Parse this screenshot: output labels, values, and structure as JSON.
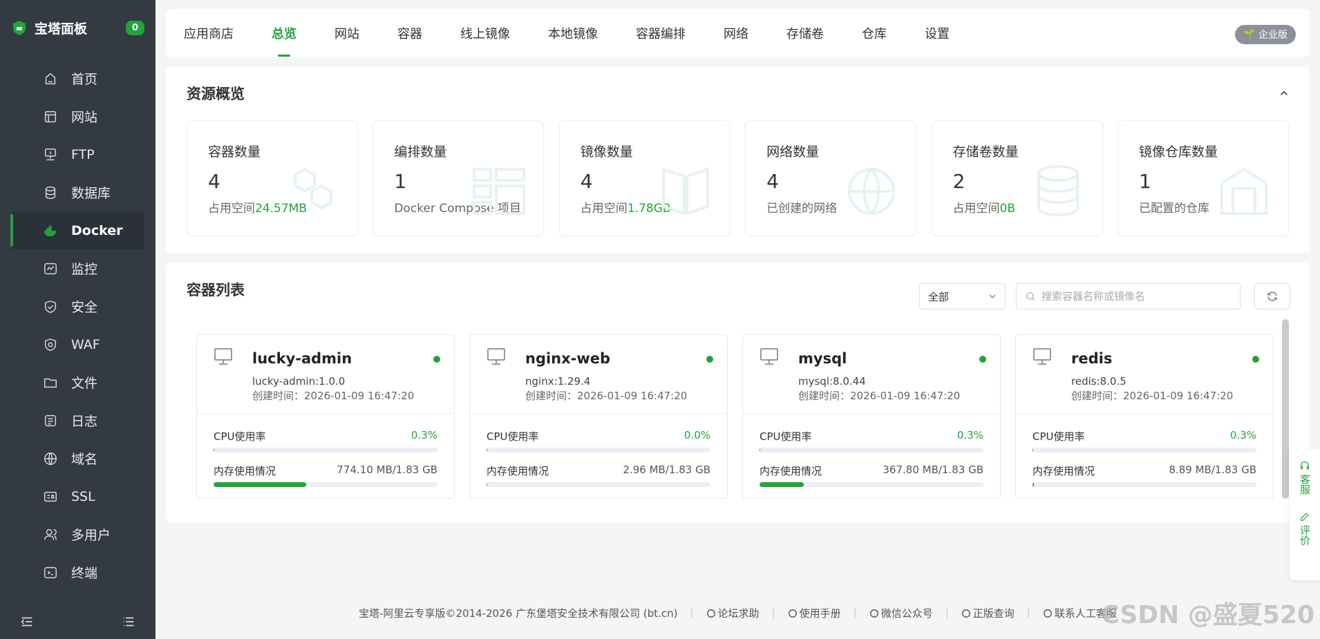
{
  "brand": {
    "title": "宝塔面板",
    "badge": "0"
  },
  "sidebar": {
    "items": [
      {
        "label": "首页",
        "icon": "home-icon"
      },
      {
        "label": "网站",
        "icon": "website-icon"
      },
      {
        "label": "FTP",
        "icon": "ftp-icon"
      },
      {
        "label": "数据库",
        "icon": "database-icon"
      },
      {
        "label": "Docker",
        "icon": "docker-icon",
        "active": true
      },
      {
        "label": "监控",
        "icon": "monitor-icon"
      },
      {
        "label": "安全",
        "icon": "shield-icon"
      },
      {
        "label": "WAF",
        "icon": "waf-icon"
      },
      {
        "label": "文件",
        "icon": "folder-icon"
      },
      {
        "label": "日志",
        "icon": "log-icon"
      },
      {
        "label": "域名",
        "icon": "globe-icon"
      },
      {
        "label": "SSL",
        "icon": "ssl-icon"
      },
      {
        "label": "多用户",
        "icon": "users-icon"
      },
      {
        "label": "终端",
        "icon": "terminal-icon"
      }
    ]
  },
  "tabs": [
    "应用商店",
    "总览",
    "网站",
    "容器",
    "线上镜像",
    "本地镜像",
    "容器编排",
    "网络",
    "存储卷",
    "仓库",
    "设置"
  ],
  "active_tab": "总览",
  "enterprise_label": "企业版",
  "overview": {
    "title": "资源概览",
    "stats": [
      {
        "label": "容器数量",
        "value": "4",
        "sub_prefix": "占用空间",
        "sub_value": "24.57MB"
      },
      {
        "label": "编排数量",
        "value": "1",
        "sub_prefix": "Docker Compose 项目",
        "sub_value": ""
      },
      {
        "label": "镜像数量",
        "value": "4",
        "sub_prefix": "占用空间",
        "sub_value": "1.78GB"
      },
      {
        "label": "网络数量",
        "value": "4",
        "sub_prefix": "已创建的网络",
        "sub_value": ""
      },
      {
        "label": "存储卷数量",
        "value": "2",
        "sub_prefix": "占用空间",
        "sub_value": "0B"
      },
      {
        "label": "镜像仓库数量",
        "value": "1",
        "sub_prefix": "已配置的仓库",
        "sub_value": ""
      }
    ]
  },
  "containers": {
    "title": "容器列表",
    "filter_value": "全部",
    "search_placeholder": "搜索容器名称或镜像名",
    "cpu_label": "CPU使用率",
    "mem_label": "内存使用情况",
    "items": [
      {
        "name": "lucky-admin",
        "image": "lucky-admin:1.0.0",
        "created": "创建时间：2026-01-09 16:47:20",
        "cpu": "0.3%",
        "cpu_frac": 0.003,
        "mem": "774.10 MB/1.83 GB",
        "mem_frac": 0.413
      },
      {
        "name": "nginx-web",
        "image": "nginx:1.29.4",
        "created": "创建时间：2026-01-09 16:47:20",
        "cpu": "0.0%",
        "cpu_frac": 0.0,
        "mem": "2.96 MB/1.83 GB",
        "mem_frac": 0.002
      },
      {
        "name": "mysql",
        "image": "mysql:8.0.44",
        "created": "创建时间：2026-01-09 16:47:20",
        "cpu": "0.3%",
        "cpu_frac": 0.003,
        "mem": "367.80 MB/1.83 GB",
        "mem_frac": 0.196
      },
      {
        "name": "redis",
        "image": "redis:8.0.5",
        "created": "创建时间：2026-01-09 16:47:20",
        "cpu": "0.3%",
        "cpu_frac": 0.003,
        "mem": "8.89 MB/1.83 GB",
        "mem_frac": 0.005
      }
    ]
  },
  "float": {
    "service": "客服",
    "review": "评价"
  },
  "footer": {
    "copyright": "宝塔-阿里云专享版©2014-2026 广东堡塔安全技术有限公司 (bt.cn)",
    "links": [
      "论坛求助",
      "使用手册",
      "微信公众号",
      "正版查询",
      "联系人工客服"
    ]
  },
  "watermark": "CSDN @盛夏520",
  "colors": {
    "accent": "#20a53a",
    "sidebar_bg": "#333a42"
  }
}
